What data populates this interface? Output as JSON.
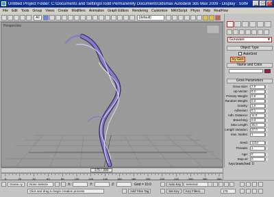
{
  "window": {
    "title": "Untitled      Project Folder: C:\\Documents and Settings\\Todd Permane\\My Documents\\3dsmax      Autodesk 3ds Max  2009      - Display : Software",
    "min_label": "_",
    "max_label": "□",
    "close_label": "×"
  },
  "menu": [
    "File",
    "Edit",
    "Tools",
    "Group",
    "Views",
    "Create",
    "Modifiers",
    "Animation",
    "Graph Editors",
    "Rendering",
    "Customize",
    "MAXScript",
    "Physx",
    "Help",
    "RealFlow"
  ],
  "toolbar": {
    "selection_filter": "All",
    "named_selection": "(default)"
  },
  "viewport": {
    "label": "Perspective"
  },
  "command_panel": {
    "category": "Guruware",
    "object_type_header": "Object Type",
    "autogrid_label": "AutoGrid",
    "ivy_button": "Ivy Gen",
    "name_color_header": "Name and Color",
    "grow_params_header": "Grow Parameters",
    "params": [
      {
        "label": "Grow Size:",
        "value": "2.0"
      },
      {
        "label": "Up-Vector:",
        "value": "0.2"
      },
      {
        "label": "Primary Weight:",
        "value": "0.5"
      },
      {
        "label": "Random Weight:",
        "value": "0.2"
      },
      {
        "label": "Gravity:",
        "value": "1.0"
      },
      {
        "label": "Adhesion:",
        "value": "0.1"
      },
      {
        "label": "Adh. Distance:",
        "value": "11.0"
      },
      {
        "label": "Branching:",
        "value": "0.3"
      },
      {
        "label": "Max Length:",
        "value": "35.0"
      },
      {
        "label": "Length Variation:",
        "value": "27.0"
      },
      {
        "label": "max. Nodes:",
        "value": "1"
      }
    ],
    "seed": {
      "label": "Seed:",
      "value": "1234"
    },
    "threads": {
      "label": "Threads:",
      "value": "1"
    },
    "age": {
      "label": "Age:",
      "value": "0"
    },
    "stop_at": {
      "label": "Stop at:",
      "value": "0"
    },
    "ivys_branched": "Ivys branched: 0"
  },
  "timeline": {
    "thumb_label": "175 / 300",
    "tick_labels": [
      "0",
      "20",
      "40",
      "60",
      "80",
      "100",
      "120",
      "140",
      "160",
      "180",
      "200",
      "220",
      "240",
      "260",
      "280",
      "300"
    ]
  },
  "status": {
    "selection": "None Selecte",
    "x_label": "X:",
    "y_label": "Y:",
    "z_label": "Z:",
    "grid": "Grid = 10.0",
    "prompt": "Click and drag to begin creation process",
    "add_time_tag": "Add Time Tag",
    "auto_key": "Auto Key",
    "selected": "Selected",
    "set_key": "Set Key",
    "key_filters": "Key Filters...",
    "frame": "175",
    "script_label": "Ocean.cy"
  },
  "colors": {
    "ivy_stem": "#8878c8",
    "ivy_dark": "#3a3060",
    "object_color": "#a0184a",
    "highlight": "#c02020"
  }
}
